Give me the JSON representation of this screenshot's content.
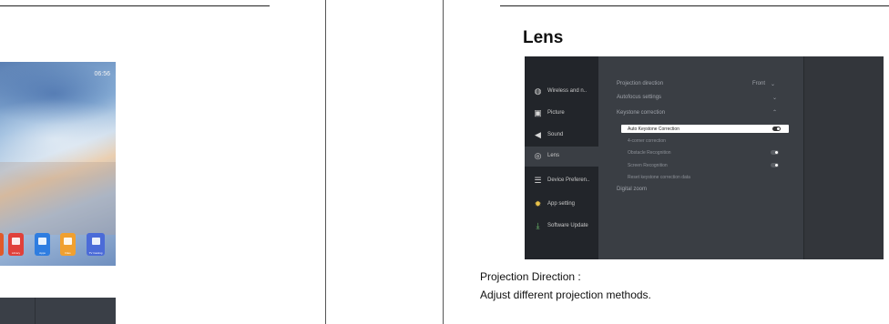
{
  "left_preview": {
    "status_time": "06:56",
    "apps": [
      {
        "label": "Library",
        "color": "#e0403a"
      },
      {
        "label": "Apps",
        "color": "#2f7de0"
      },
      {
        "label": "Files",
        "color": "#f0a030"
      },
      {
        "label": "TV Casting",
        "color": "#4b6bd8"
      }
    ]
  },
  "section": {
    "title": "Lens"
  },
  "settings_screen": {
    "sidebar": [
      {
        "label": "Wireless and n..",
        "icon": "globe-icon"
      },
      {
        "label": "Picture",
        "icon": "picture-icon"
      },
      {
        "label": "Sound",
        "icon": "speaker-icon"
      },
      {
        "label": "Lens",
        "icon": "lens-icon",
        "active": true
      },
      {
        "label": "Device Preferen..",
        "icon": "sliders-icon"
      },
      {
        "label": "App setting",
        "icon": "gear-icon"
      },
      {
        "label": "Software Update",
        "icon": "download-icon"
      }
    ],
    "items": {
      "projection_direction": {
        "label": "Projection direction",
        "value": "Front"
      },
      "autofocus": {
        "label": "Autofocus settings"
      },
      "keystone": {
        "label": "Keystone correction"
      },
      "auto_keystone": {
        "label": "Auto Keystone Correction",
        "on": true
      },
      "four_corner": {
        "label": "4-corner correction"
      },
      "obstacle": {
        "label": "Obstacle Recognition",
        "on": true
      },
      "screen_recognition": {
        "label": "Screen Recognition",
        "on": true
      },
      "reset_keystone": {
        "label": "Reset keystone correction data"
      },
      "digital_zoom": {
        "label": "Digital zoom"
      }
    }
  },
  "caption": {
    "heading": "Projection Direction :",
    "body": "Adjust different projection methods."
  }
}
